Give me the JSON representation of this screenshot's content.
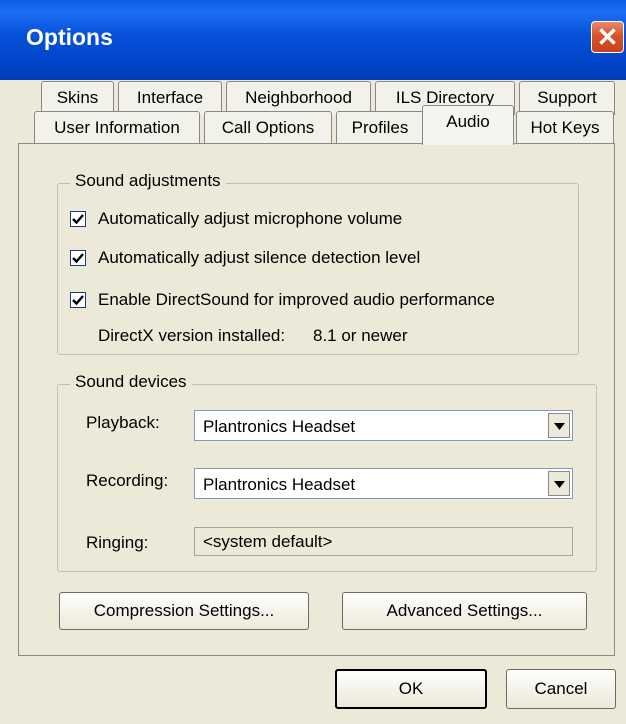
{
  "window": {
    "title": "Options",
    "close_glyph": "✕"
  },
  "tabs_row1": [
    "Skins",
    "Interface",
    "Neighborhood",
    "ILS Directory",
    "Support"
  ],
  "tabs_row2": [
    "User Information",
    "Call Options",
    "Profiles",
    "Audio",
    "Hot Keys"
  ],
  "active_tab": "Audio",
  "sound_adjustments": {
    "legend": "Sound adjustments",
    "options": [
      {
        "label": "Automatically adjust microphone volume",
        "checked": true
      },
      {
        "label": "Automatically adjust silence detection level",
        "checked": true
      },
      {
        "label": "Enable DirectSound for improved audio performance",
        "checked": true
      }
    ],
    "directx_label": "DirectX version installed:",
    "directx_value": "8.1 or newer"
  },
  "sound_devices": {
    "legend": "Sound devices",
    "playback_label": "Playback:",
    "playback_value": "Plantronics Headset",
    "recording_label": "Recording:",
    "recording_value": "Plantronics Headset",
    "ringing_label": "Ringing:",
    "ringing_value": "<system default>"
  },
  "buttons": {
    "compression": "Compression Settings...",
    "advanced": "Advanced Settings...",
    "ok": "OK",
    "cancel": "Cancel"
  },
  "icons": {
    "close": "close-icon",
    "checkbox": "checkmark-icon",
    "dropdown": "chevron-down-icon"
  }
}
